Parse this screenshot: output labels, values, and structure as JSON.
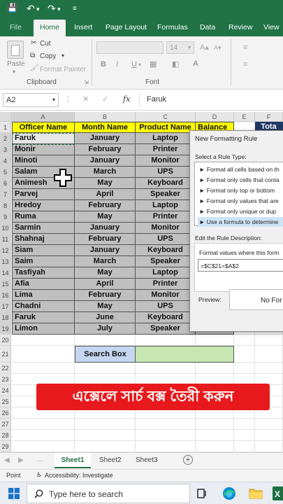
{
  "ribbon_tabs": [
    "File",
    "Home",
    "Insert",
    "Page Layout",
    "Formulas",
    "Data",
    "Review",
    "View"
  ],
  "ribbon": {
    "paste_label": "Paste",
    "cut_label": "Cut",
    "copy_label": "Copy",
    "format_painter_label": "Format Painter",
    "clipboard_group": "Clipboard",
    "font_group": "Font",
    "font_size": "14",
    "bold": "B",
    "italic": "I",
    "underline": "U"
  },
  "formula_bar": {
    "name_box": "A2",
    "fx": "fx",
    "content": "Faruk"
  },
  "columns": [
    "A",
    "B",
    "C",
    "D",
    "E",
    "F"
  ],
  "table": {
    "headers": [
      "Officer Name",
      "Month Name",
      "Product Name",
      "Balance"
    ],
    "rows": [
      [
        "Faruk",
        "January",
        "Laptop"
      ],
      [
        "Monir",
        "February",
        "Printer"
      ],
      [
        "Minoti",
        "January",
        "Monitor"
      ],
      [
        "Salam",
        "March",
        "UPS"
      ],
      [
        "Animesh",
        "May",
        "Keyboard"
      ],
      [
        "Parvej",
        "April",
        "Speaker"
      ],
      [
        "Hredoy",
        "February",
        "Laptop"
      ],
      [
        "Ruma",
        "May",
        "Printer"
      ],
      [
        "Sarmin",
        "January",
        "Monitor"
      ],
      [
        "Shahnaj",
        "February",
        "UPS"
      ],
      [
        "Siam",
        "January",
        "Keyboard"
      ],
      [
        "Saim",
        "March",
        "Speaker"
      ],
      [
        "Tasfiyah",
        "May",
        "Laptop"
      ],
      [
        "Afia",
        "April",
        "Printer"
      ],
      [
        "Lima",
        "February",
        "Monitor"
      ],
      [
        "Chadni",
        "May",
        "UPS"
      ],
      [
        "Faruk",
        "June",
        "Keyboard"
      ],
      [
        "Limon",
        "July",
        "Speaker"
      ]
    ],
    "f1_label": "Tota"
  },
  "row_numbers": [
    "1",
    "2",
    "3",
    "4",
    "5",
    "6",
    "7",
    "8",
    "9",
    "10",
    "11",
    "12",
    "13",
    "14",
    "15",
    "16",
    "17",
    "18",
    "19",
    "20",
    "21",
    "22",
    "23",
    "24",
    "25",
    "26",
    "27",
    "28",
    "29"
  ],
  "search": {
    "label": "Search Box",
    "value": ""
  },
  "dialog": {
    "title": "New Formatting Rule",
    "select_rule_type": "Select a Rule Type:",
    "rule_types": [
      "► Format all cells based on th",
      "► Format only cells that conta",
      "► Format only top or bottom",
      "► Format only values that are",
      "► Format only unique or dup",
      "► Use a formula to determine"
    ],
    "edit_description": "Edit the Rule Description:",
    "format_values_label": "Format values where this form",
    "formula": "=$C$21=$A$2",
    "preview_label": "Preview:",
    "preview_text": "No For"
  },
  "banner": "এক্সেলে সার্চ বক্স তৈরী করুন",
  "sheets": [
    "Sheet1",
    "Sheet2",
    "Sheet3"
  ],
  "active_sheet": "Sheet1",
  "status": {
    "mode": "Point",
    "accessibility": "Accessibility: Investigate"
  },
  "taskbar": {
    "search_placeholder": "Type here to search"
  },
  "colors": {
    "excel_green": "#217346",
    "header_yellow": "#ffff00",
    "data_gray": "#bfbfbf",
    "search_label_bg": "#c5d6f0",
    "search_input_bg": "#c6e6b3",
    "banner_red": "#e8191c"
  }
}
